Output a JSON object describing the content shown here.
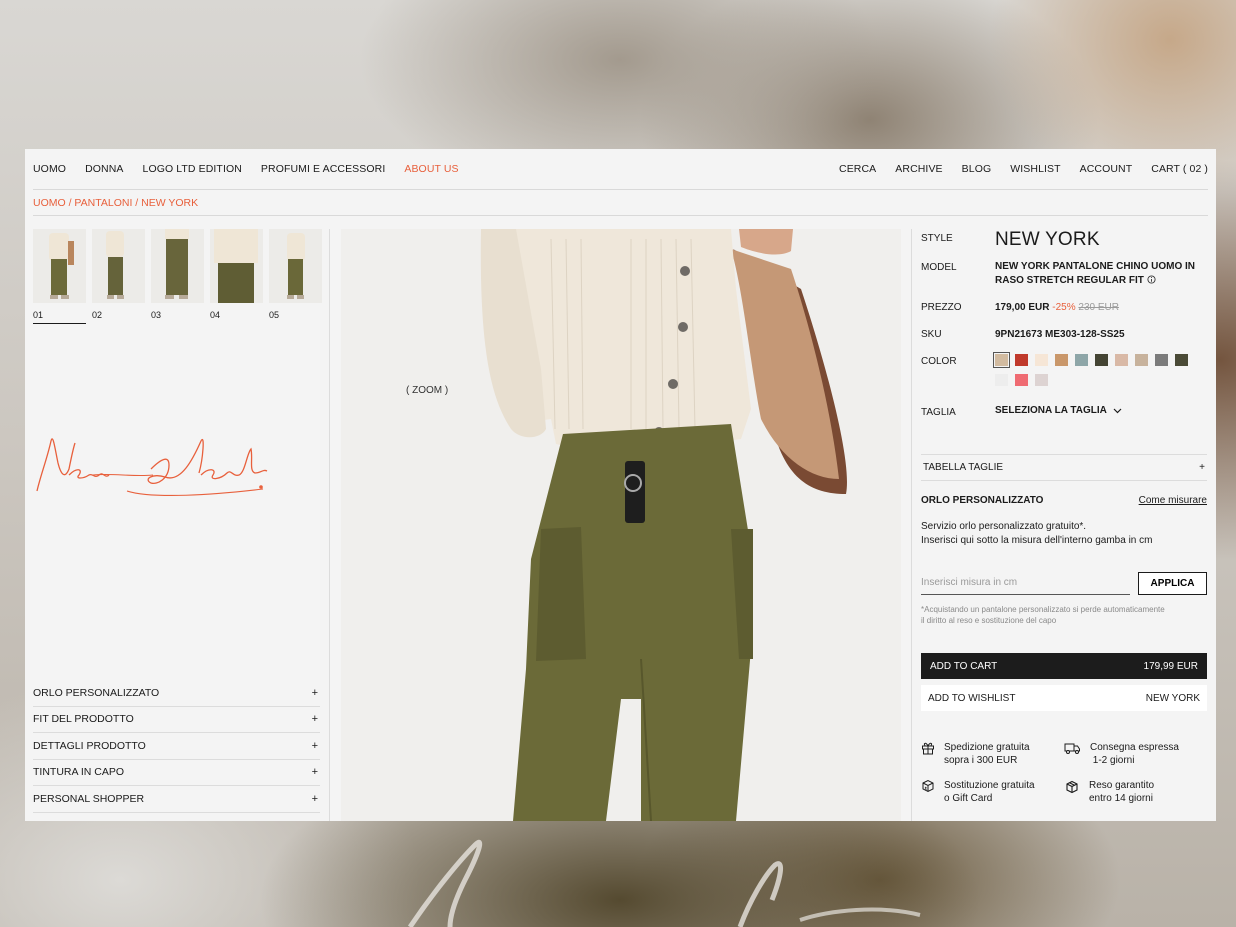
{
  "nav": {
    "left": [
      "UOMO",
      "DONNA",
      "LOGO LTD EDITION",
      "PROFUMI E ACCESSORI",
      "ABOUT US"
    ],
    "right": [
      "CERCA",
      "ARCHIVE",
      "BLOG",
      "WISHLIST",
      "ACCOUNT",
      "CART ( 02 )"
    ],
    "accent_color": "#e8603c"
  },
  "breadcrumb": "UOMO / PANTALONI / NEW YORK",
  "gallery": {
    "thumbs": [
      "01",
      "02",
      "03",
      "04",
      "05"
    ],
    "active": "01",
    "zoom_label": "( ZOOM )"
  },
  "left_accordion": [
    "ORLO PERSONALIZZATO",
    "FIT DEL PRODOTTO",
    "DETTAGLI PRODOTTO",
    "TINTURA IN CAPO",
    "PERSONAL SHOPPER"
  ],
  "plus": "+",
  "product": {
    "style_label": "STYLE",
    "style": "NEW YORK",
    "model_label": "MODEL",
    "model": "NEW YORK PANTALONE CHINO UOMO IN RASO STRETCH REGULAR FIT",
    "price_label": "PREZZO",
    "price": "179,00 EUR",
    "discount": "-25%",
    "old_price": "230 EUR",
    "sku_label": "SKU",
    "sku": "9PN21673 ME303-128-SS25",
    "color_label": "COLOR",
    "colors": [
      "#d2bba0",
      "#c0392b",
      "#f6e6d6",
      "#c9976a",
      "#8ea6a8",
      "#444433",
      "#d9b9a6",
      "#c7b29c",
      "#7b7b7b",
      "#4a4a36",
      "#ededed",
      "#ef6b72",
      "#ddd3d2"
    ],
    "size_label": "TAGLIA",
    "size_select": "SELEZIONA LA TAGLIA"
  },
  "size_table": "TABELLA TAGLIE",
  "orlo": {
    "title": "ORLO PERSONALIZZATO",
    "link": "Come misurare",
    "desc1": "Servizio orlo personalizzato gratuito*.",
    "desc2": "Inserisci qui sotto la misura dell'interno gamba in cm",
    "placeholder": "Inserisci misura in cm",
    "apply": "APPLICA",
    "note1": "*Acquistando un pantalone personalizzato si perde automaticamente",
    "note2": "il diritto al reso e sostituzione del capo"
  },
  "cart": {
    "label": "ADD TO CART",
    "price": "179,99 EUR"
  },
  "wishlist": {
    "label": "ADD TO WISHLIST",
    "name": "NEW YORK"
  },
  "perks": [
    {
      "icon": "gift-icon",
      "line1": "Spedizione gratuita",
      "line2": "sopra i 300 EUR"
    },
    {
      "icon": "truck-icon",
      "line1": "Consegna espressa",
      "line2": " 1-2 giorni"
    },
    {
      "icon": "box-swap-icon",
      "line1": "Sostituzione gratuita",
      "line2": "o Gift Card"
    },
    {
      "icon": "box-return-icon",
      "line1": "Reso garantito",
      "line2": "entro 14 giorni"
    }
  ]
}
